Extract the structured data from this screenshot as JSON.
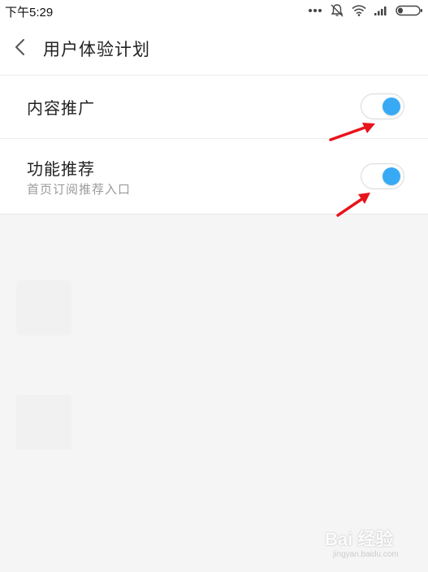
{
  "status_bar": {
    "time": "下午5:29",
    "icons": [
      "more-dots-icon",
      "mute-bell-icon",
      "wifi-icon",
      "signal-icon",
      "battery-icon"
    ]
  },
  "header": {
    "title": "用户体验计划",
    "back_icon": "chevron-left-icon"
  },
  "settings": [
    {
      "label": "内容推广",
      "subtitle": "",
      "enabled": true
    },
    {
      "label": "功能推荐",
      "subtitle": "首页订阅推荐入口",
      "enabled": true
    }
  ],
  "colors": {
    "accent": "#38aaf5",
    "annotation_arrow": "#e8141c",
    "background": "#f5f5f5"
  },
  "watermark": {
    "text": "Bai 经验",
    "url": "jingyan.baidu.com"
  }
}
